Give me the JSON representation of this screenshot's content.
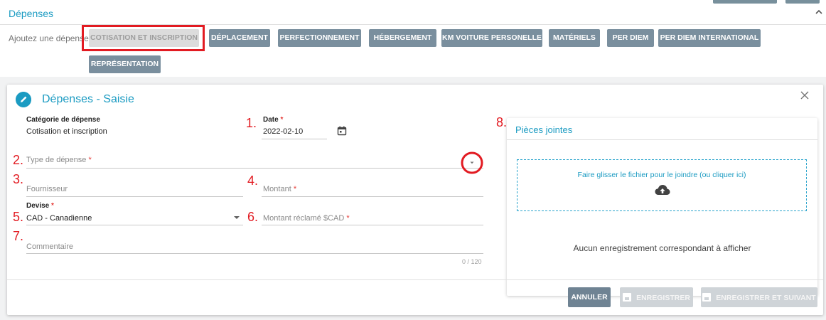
{
  "section": {
    "title": "Dépenses"
  },
  "add_bar": {
    "label": "Ajoutez une dépense:",
    "categories": [
      "COTISATION ET INSCRIPTION",
      "DÉPLACEMENT",
      "PERFECTIONNEMENT",
      "HÉBERGEMENT",
      "KM VOITURE PERSONELLE",
      "MATÉRIELS",
      "PER DIEM",
      "PER DIEM INTERNATIONAL",
      "REPRÉSENTATION"
    ],
    "active_category": "COTISATION ET INSCRIPTION"
  },
  "modal": {
    "title": "Dépenses - Saisie",
    "category": {
      "label": "Catégorie de dépense",
      "value": "Cotisation et inscription"
    },
    "date": {
      "label": "Date",
      "required": "*",
      "value": "2022-02-10"
    },
    "expense_type": {
      "placeholder": "Type de dépense",
      "required": "*"
    },
    "supplier": {
      "placeholder": "Fournisseur"
    },
    "amount": {
      "placeholder": "Montant",
      "required": "*"
    },
    "currency": {
      "label": "Devise",
      "required": "*",
      "value": "CAD - Canadienne"
    },
    "claimed_amount": {
      "placeholder": "Montant réclamé $CAD",
      "required": "*"
    },
    "comment": {
      "placeholder": "Commentaire",
      "counter": "0 / 120"
    },
    "attachments": {
      "title": "Pièces jointes",
      "dropzone_text": "Faire glisser le fichier pour le joindre (ou cliquer ici)",
      "empty_message": "Aucun enregistrement correspondant à afficher"
    },
    "buttons": {
      "cancel": "ANNULER",
      "save": "ENREGISTRER",
      "save_next": "ENREGISTRER ET SUIVANT"
    }
  },
  "annotations": [
    "1.",
    "2.",
    "3.",
    "4.",
    "5.",
    "6.",
    "7.",
    "8."
  ],
  "colors": {
    "accent": "#1b9bc2",
    "button": "#7a8f9e",
    "annotation": "#e21b22"
  },
  "icons": [
    "chevron-up-icon",
    "pencil-icon",
    "close-icon",
    "calendar-icon",
    "chevron-down-icon",
    "dropdown-arrow-icon",
    "cloud-upload-icon",
    "save-icon"
  ]
}
